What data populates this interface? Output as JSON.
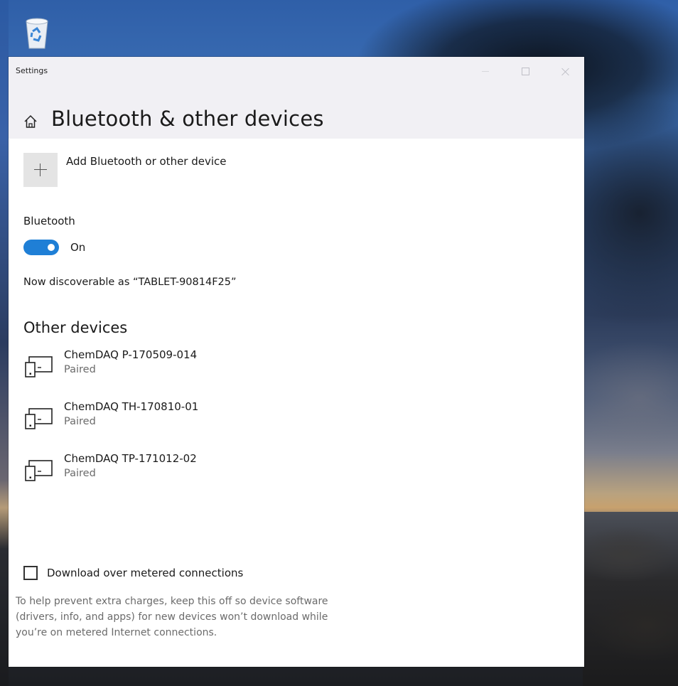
{
  "window": {
    "app_title": "Settings",
    "page_title": "Bluetooth & other devices"
  },
  "add_device": {
    "label": "Add Bluetooth or other device",
    "icon": "plus-icon"
  },
  "bluetooth": {
    "heading": "Bluetooth",
    "toggle_state": "On",
    "toggle_on": true,
    "discoverable_text": "Now discoverable as “TABLET-90814F25”"
  },
  "other_devices": {
    "title": "Other devices",
    "items": [
      {
        "name": "ChemDAQ P-170509-014",
        "status": "Paired",
        "icon": "device-icon"
      },
      {
        "name": "ChemDAQ TH-170810-01",
        "status": "Paired",
        "icon": "device-icon"
      },
      {
        "name": "ChemDAQ TP-171012-02",
        "status": "Paired",
        "icon": "device-icon"
      }
    ]
  },
  "metered": {
    "checkbox_label": "Download over metered connections",
    "checked": false,
    "help_lines": [
      "To help prevent extra charges, keep this off so device software",
      "(drivers, info, and apps) for new devices won’t download while",
      "you’re on metered Internet connections."
    ]
  },
  "colors": {
    "accent": "#1f7fd6",
    "titlebar": "#f1f0f4",
    "secondary_text": "#6b6b6b"
  }
}
